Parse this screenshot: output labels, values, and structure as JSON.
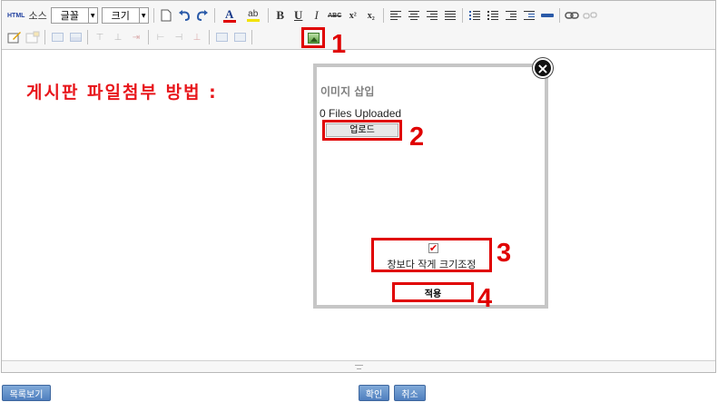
{
  "toolbar": {
    "html_label": "HTML",
    "source_label": "소스",
    "font_select": "글꼴",
    "size_select": "크기",
    "bold": "B",
    "underline": "U",
    "italic": "I",
    "strike": "ABC",
    "superscript": "x²",
    "subscript": "x₂",
    "font_color_letter": "A",
    "highlight_letter": "ab"
  },
  "title": "게시판 파일첨부 방법 :",
  "steps": {
    "one": "1",
    "two": "2",
    "three": "3",
    "four": "4"
  },
  "dialog": {
    "title": "이미지 삽입",
    "files_uploaded": "0 Files Uploaded",
    "upload_label": "업로드",
    "resize_label": "창보다 작게 크기조정",
    "apply_label": "적용",
    "close": "×"
  },
  "footer": {
    "list_label": "목록보기",
    "confirm_label": "확인",
    "cancel_label": "취소"
  },
  "colors": {
    "accent_red": "#e00000",
    "title_red": "#e8161b",
    "button_blue": "#4f7fbf"
  }
}
